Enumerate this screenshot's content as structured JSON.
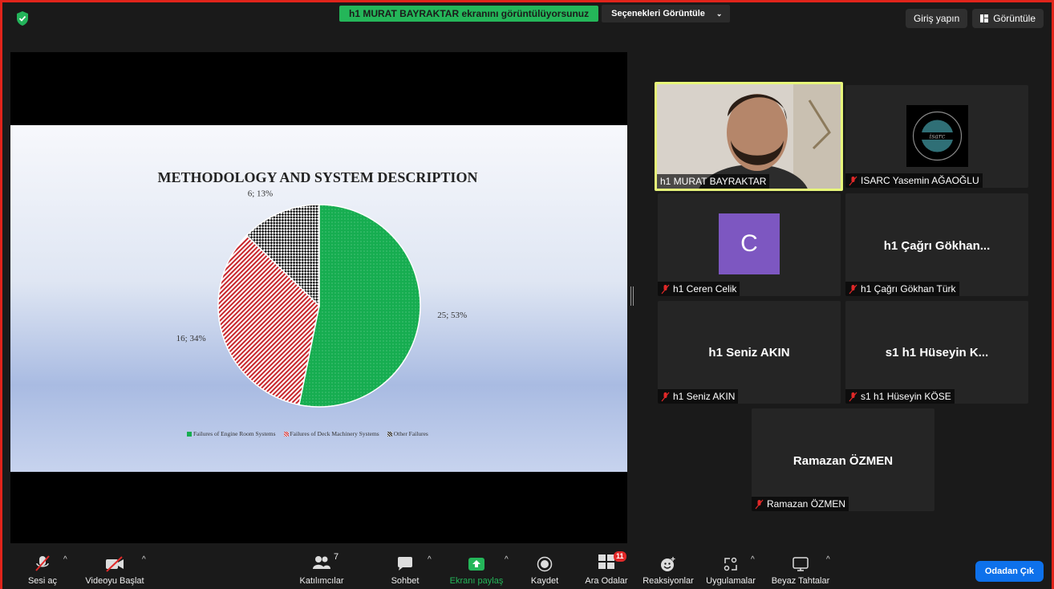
{
  "top_bar": {
    "share_message": "h1 MURAT BAYRAKTAR ekranını görüntülüyorsunuz",
    "view_options_label": "Seçenekleri Görüntüle",
    "sign_in_label": "Giriş yapın",
    "view_label": "Görüntüle"
  },
  "slide": {
    "title": "METHODOLOGY AND SYSTEM DESCRIPTION",
    "legend": [
      "Failures of Engine Room Systems",
      "Failures of Deck Machinery Systems",
      "Other Failures"
    ]
  },
  "chart_data": {
    "type": "pie",
    "title": "METHODOLOGY AND SYSTEM DESCRIPTION",
    "categories": [
      "Failures of Engine Room Systems",
      "Failures of Deck Machinery Systems",
      "Other Failures"
    ],
    "values": [
      25,
      16,
      6
    ],
    "percentages": [
      53,
      34,
      13
    ],
    "data_labels": [
      "25; 53%",
      "16; 34%",
      "6; 13%"
    ],
    "colors": [
      "#16ad50",
      "#c8262c",
      "#111111"
    ],
    "legend_position": "bottom"
  },
  "participants": [
    {
      "id": "murat",
      "name": "h1 MURAT BAYRAKTAR",
      "muted": false,
      "active_speaker": true,
      "video": true
    },
    {
      "id": "isarc",
      "name": "ISARC Yasemin AĞAOĞLU",
      "muted": true,
      "logo": "isarc"
    },
    {
      "id": "ceren",
      "name": "h1 Ceren Celik",
      "muted": true,
      "avatar_letter": "C",
      "avatar_color": "#7d57c1"
    },
    {
      "id": "cagri",
      "name": "h1 Çağrı Gökhan Türk",
      "muted": true,
      "display_name": "h1 Çağrı Gökhan..."
    },
    {
      "id": "seniz",
      "name": "h1 Seniz AKIN",
      "muted": true,
      "display_name": "h1 Seniz AKIN"
    },
    {
      "id": "huseyin",
      "name": "s1 h1 Hüseyin KÖSE",
      "muted": true,
      "display_name": "s1 h1 Hüseyin K..."
    },
    {
      "id": "ramazan",
      "name": "Ramazan ÖZMEN",
      "muted": true,
      "display_name": "Ramazan ÖZMEN"
    }
  ],
  "toolbar": {
    "unmute": "Sesi aç",
    "start_video": "Videoyu Başlat",
    "participants": "Katılımcılar",
    "participants_count": "7",
    "chat": "Sohbet",
    "share_screen": "Ekranı paylaş",
    "record": "Kaydet",
    "breakout": "Ara Odalar",
    "breakout_count": "11",
    "reactions": "Reaksiyonlar",
    "apps": "Uygulamalar",
    "whiteboards": "Beyaz Tahtalar",
    "leave": "Odadan Çık"
  },
  "colors": {
    "accent_green": "#24b659",
    "leave_blue": "#0e71eb",
    "frame_red": "#e0241b",
    "speaker_border": "#e7f67a"
  }
}
